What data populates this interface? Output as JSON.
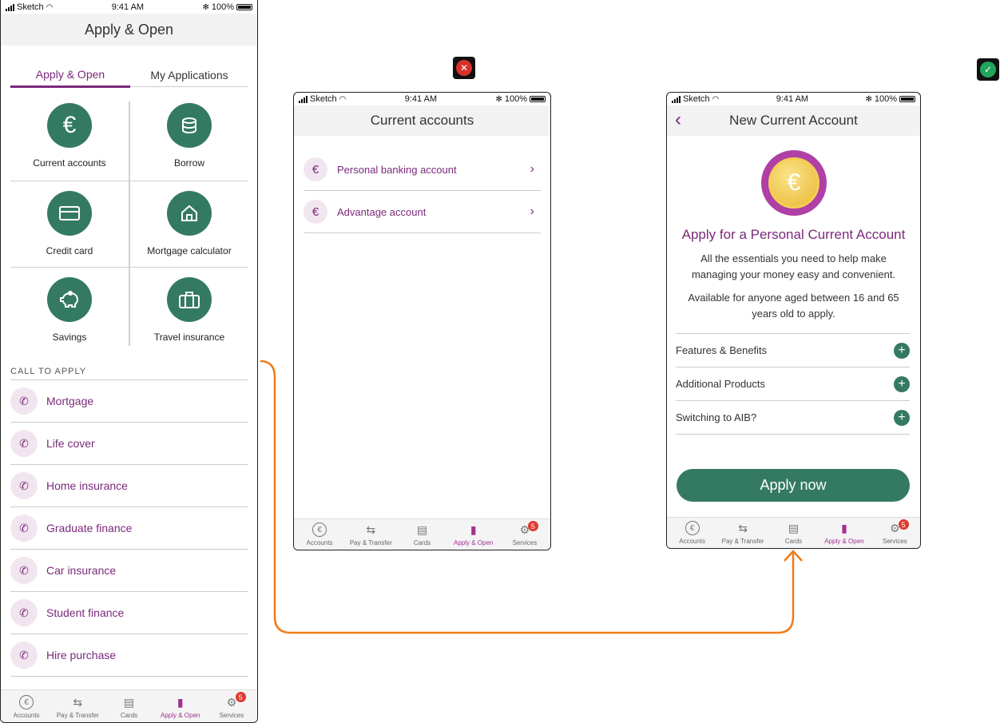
{
  "status": {
    "carrier": "Sketch",
    "time": "9:41 AM",
    "battery": "100%"
  },
  "screen1": {
    "title": "Apply & Open",
    "tabs": [
      {
        "label": "Apply & Open"
      },
      {
        "label": "My Applications"
      }
    ],
    "tiles": [
      {
        "label": "Current accounts",
        "icon": "euro-icon"
      },
      {
        "label": "Borrow",
        "icon": "coins-icon"
      },
      {
        "label": "Credit card",
        "icon": "credit-card-icon"
      },
      {
        "label": "Mortgage calculator",
        "icon": "house-icon"
      },
      {
        "label": "Savings",
        "icon": "piggy-bank-icon"
      },
      {
        "label": "Travel insurance",
        "icon": "suitcase-icon"
      }
    ],
    "section_title": "CALL TO APPLY",
    "call_items": [
      {
        "label": "Mortgage"
      },
      {
        "label": "Life cover"
      },
      {
        "label": "Home insurance"
      },
      {
        "label": "Graduate finance"
      },
      {
        "label": "Car insurance"
      },
      {
        "label": "Student finance"
      },
      {
        "label": "Hire purchase"
      }
    ]
  },
  "screen2": {
    "title": "Current accounts",
    "items": [
      {
        "label": "Personal banking account"
      },
      {
        "label": "Advantage account"
      }
    ]
  },
  "screen3": {
    "title": "New Current Account",
    "heading": "Apply for a Personal Current Account",
    "para1": "All the essentials you need to help make managing your money easy and convenient.",
    "para2": "Available for anyone aged between 16 and 65 years old to apply.",
    "accordions": [
      {
        "label": "Features & Benefits"
      },
      {
        "label": "Additional Products"
      },
      {
        "label": "Switching to AIB?"
      }
    ],
    "cta": "Apply now"
  },
  "tabbar": [
    {
      "label": "Accounts",
      "icon": "euro-circle-icon"
    },
    {
      "label": "Pay & Transfer",
      "icon": "arrows-icon"
    },
    {
      "label": "Cards",
      "icon": "cards-icon"
    },
    {
      "label": "Apply & Open",
      "icon": "door-icon"
    },
    {
      "label": "Services",
      "icon": "gear-icon",
      "badge": "5"
    }
  ],
  "annotations": {
    "wrong_marker": "✕",
    "right_marker": "✓"
  },
  "colors": {
    "accent": "#7a2a7a",
    "green": "#347a62",
    "active_tab": "#a0308f",
    "flow_arrow": "#ef7b1a",
    "error": "#d9302b",
    "success": "#21a55a"
  }
}
